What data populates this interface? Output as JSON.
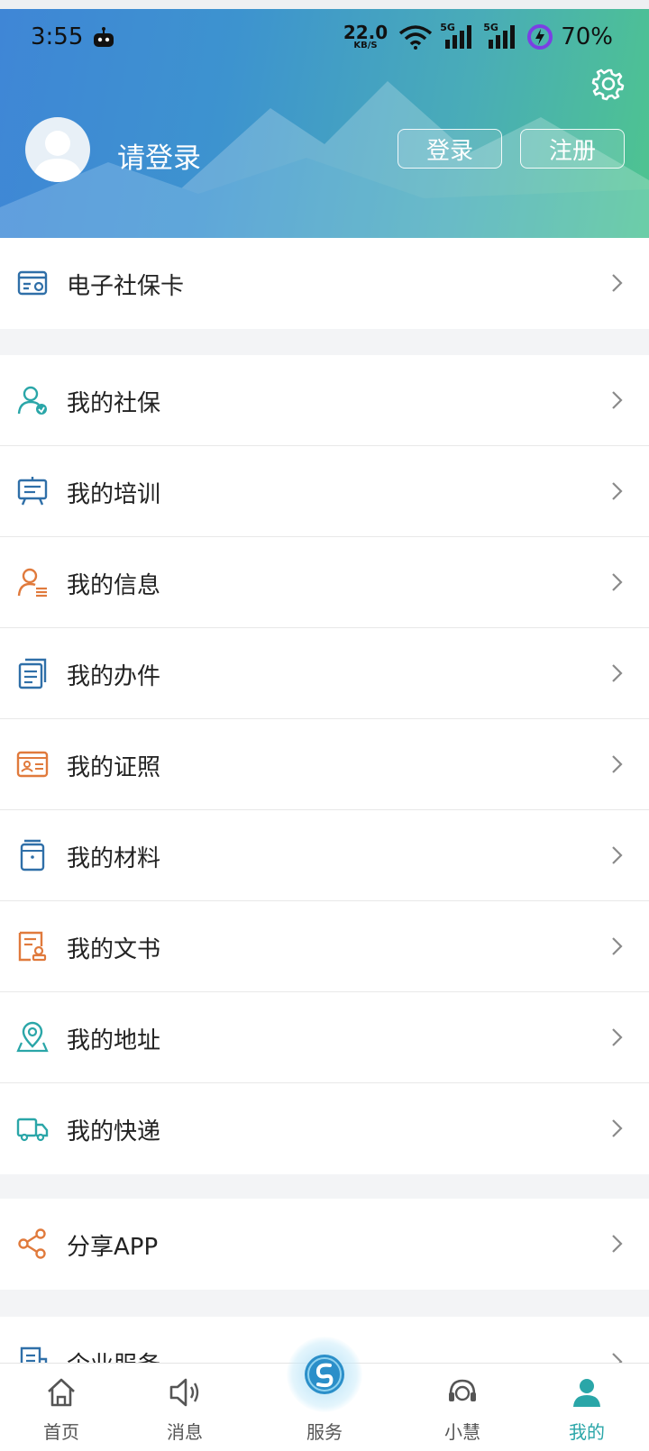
{
  "status_bar": {
    "time": "3:55",
    "net_speed_value": "22.0",
    "net_speed_unit": "KB/S",
    "signal_1_label": "5G",
    "signal_2_label": "5G",
    "battery": "70%"
  },
  "header": {
    "login_prompt": "请登录",
    "login_button": "登录",
    "register_button": "注册"
  },
  "groups": [
    {
      "items": [
        {
          "label": "电子社保卡",
          "icon": "social-card-icon"
        }
      ]
    },
    {
      "items": [
        {
          "label": "我的社保",
          "icon": "user-insurance-icon"
        },
        {
          "label": "我的培训",
          "icon": "training-board-icon"
        },
        {
          "label": "我的信息",
          "icon": "user-info-icon"
        },
        {
          "label": "我的办件",
          "icon": "documents-icon"
        },
        {
          "label": "我的证照",
          "icon": "id-card-icon"
        },
        {
          "label": "我的材料",
          "icon": "folder-icon"
        },
        {
          "label": "我的文书",
          "icon": "stamp-document-icon"
        },
        {
          "label": "我的地址",
          "icon": "location-pin-icon"
        },
        {
          "label": "我的快递",
          "icon": "delivery-truck-icon"
        }
      ]
    },
    {
      "items": [
        {
          "label": "分享APP",
          "icon": "share-icon"
        }
      ]
    },
    {
      "items": [
        {
          "label": "企业服务",
          "icon": "enterprise-icon"
        }
      ]
    }
  ],
  "bottom_nav": [
    {
      "label": "首页",
      "icon": "home-icon"
    },
    {
      "label": "消息",
      "icon": "speaker-icon"
    },
    {
      "label": "服务",
      "icon": "service-logo-icon"
    },
    {
      "label": "小慧",
      "icon": "headset-icon"
    },
    {
      "label": "我的",
      "icon": "person-icon",
      "active": true
    }
  ],
  "colors": {
    "accent": "#2aa6a8",
    "header_start": "#3f86d6",
    "header_end": "#4ec48f",
    "icon_blue": "#2f6fa8",
    "icon_orange": "#e07a3c",
    "icon_teal": "#2aa6a8"
  }
}
